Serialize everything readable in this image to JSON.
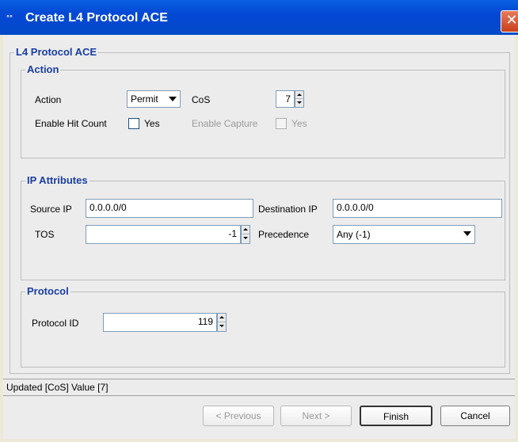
{
  "window": {
    "title": "Create L4 Protocol ACE",
    "close_label": "✕"
  },
  "outer_group": {
    "label": "L4 Protocol ACE"
  },
  "action_group": {
    "label": "Action",
    "action_label": "Action",
    "action_value": "Permit",
    "cos_label": "CoS",
    "cos_value": "7",
    "hit_count_label": "Enable Hit Count",
    "hit_count_check_label": "Yes",
    "capture_label": "Enable Capture",
    "capture_check_label": "Yes"
  },
  "ip_group": {
    "label": "IP Attributes",
    "source_ip_label": "Source IP",
    "source_ip_value": "0.0.0.0/0",
    "dest_ip_label": "Destination IP",
    "dest_ip_value": "0.0.0.0/0",
    "tos_label": "TOS",
    "tos_value": "-1",
    "precedence_label": "Precedence",
    "precedence_value": "Any (-1)"
  },
  "protocol_group": {
    "label": "Protocol",
    "protocol_id_label": "Protocol ID",
    "protocol_id_value": "119"
  },
  "status": {
    "text": "Updated [CoS] Value [7]"
  },
  "buttons": {
    "previous": "< Previous",
    "next": "Next >",
    "finish": "Finish",
    "cancel": "Cancel"
  }
}
